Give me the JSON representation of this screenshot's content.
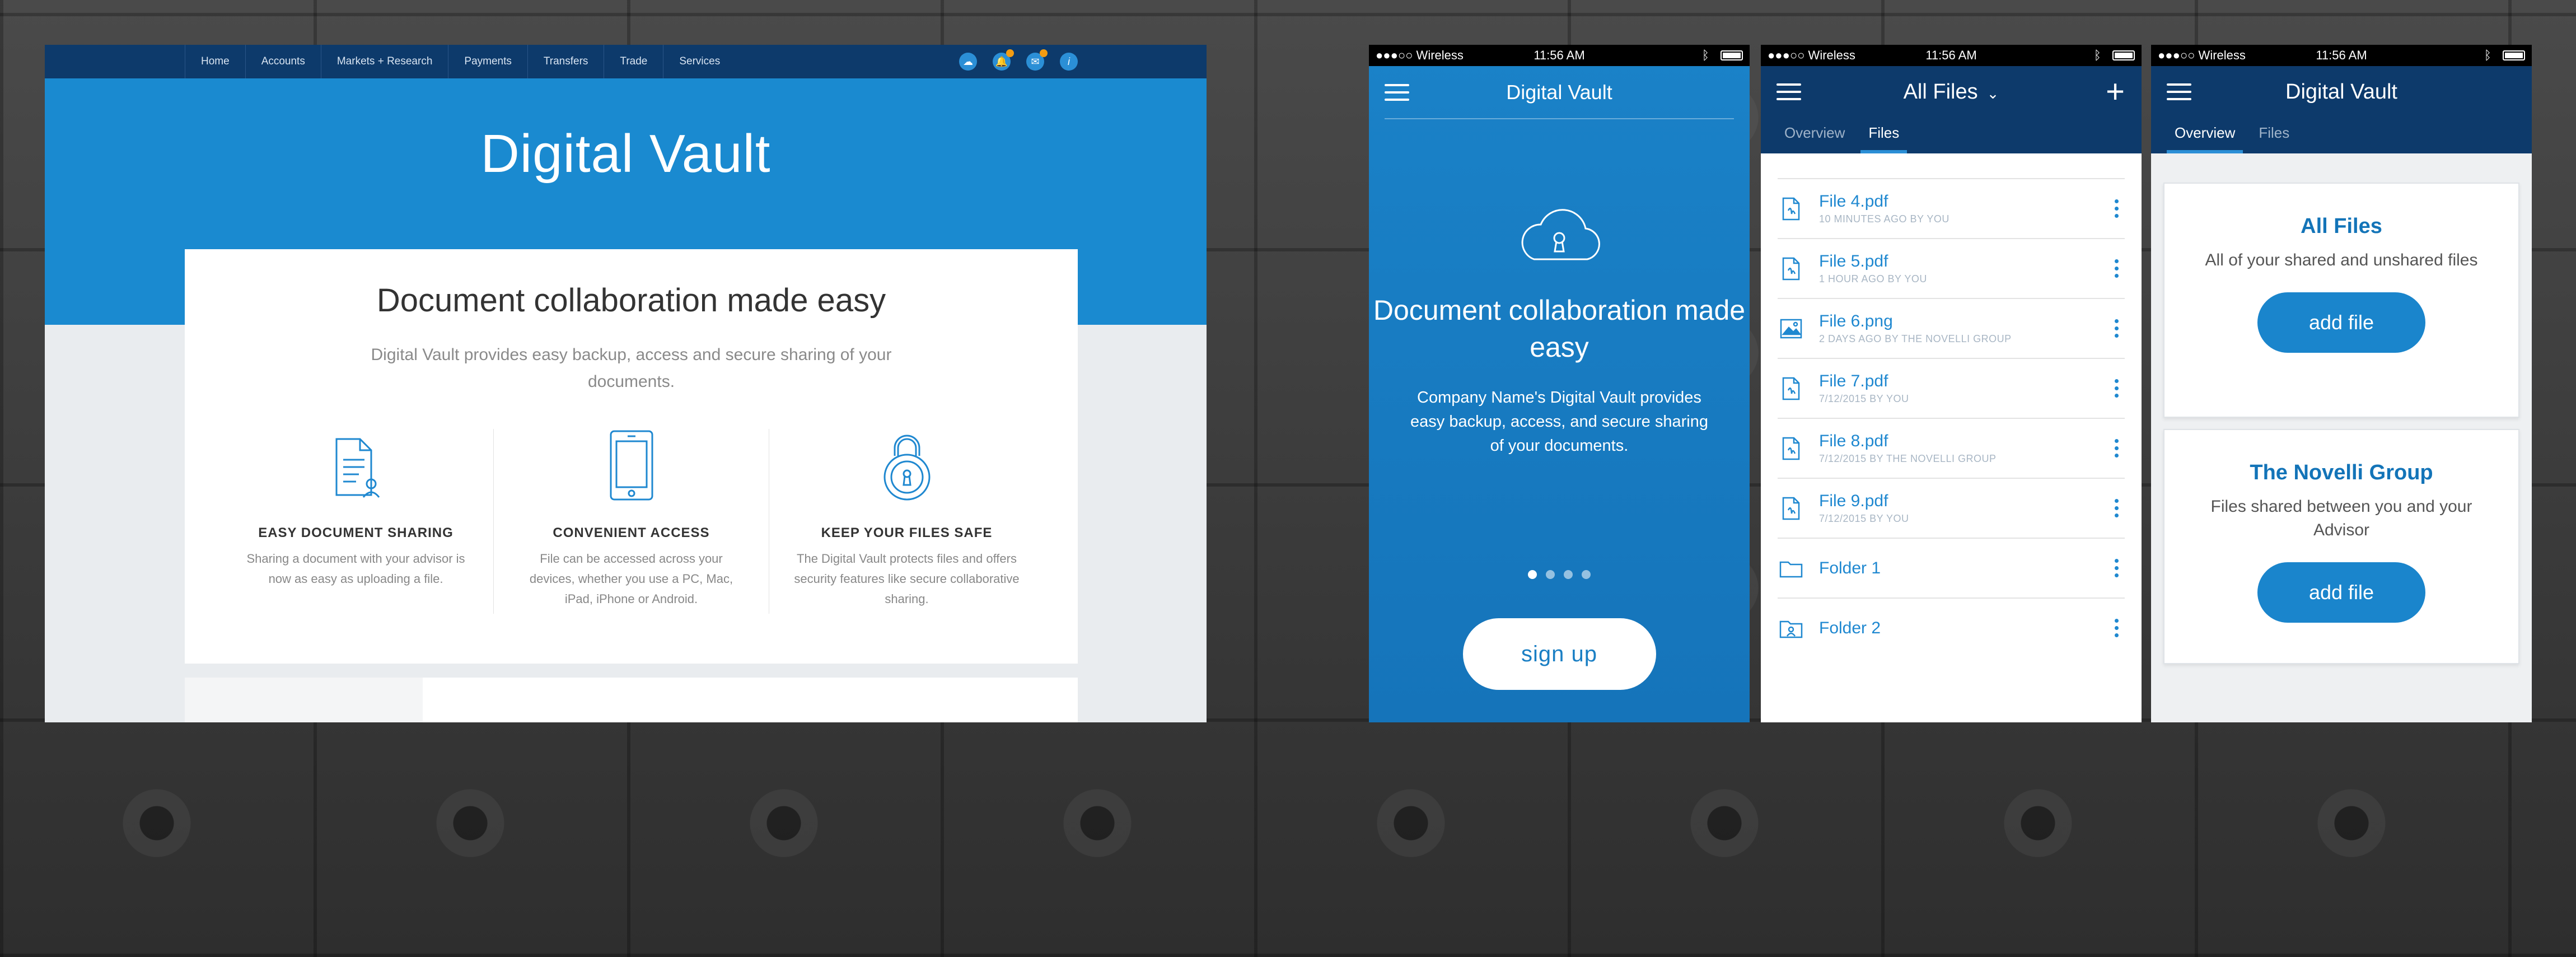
{
  "desktop": {
    "nav": {
      "items": [
        "Home",
        "Accounts",
        "Markets + Research",
        "Payments",
        "Transfers",
        "Trade",
        "Services"
      ],
      "icons": [
        "cloud-icon",
        "bell-icon",
        "mail-icon",
        "info-icon"
      ]
    },
    "hero_title": "Digital Vault",
    "card": {
      "title": "Document collaboration made easy",
      "subtitle": "Digital Vault provides easy backup, access and secure sharing of your documents.",
      "features": [
        {
          "icon": "document-share-icon",
          "title": "EASY DOCUMENT SHARING",
          "text": "Sharing a document with your advisor is now as easy as uploading a file."
        },
        {
          "icon": "tablet-icon",
          "title": "CONVENIENT ACCESS",
          "text": "File can be accessed across your devices, whether you use a PC, Mac, iPad, iPhone or Android."
        },
        {
          "icon": "padlock-icon",
          "title": "KEEP YOUR FILES SAFE",
          "text": "The Digital Vault protects files and offers security features like secure collaborative sharing."
        }
      ]
    }
  },
  "status": {
    "carrier": "●●●○○ Wireless",
    "time": "11:56 AM"
  },
  "phone1": {
    "title": "Digital Vault",
    "heading": "Document collaboration made easy",
    "body": "Company Name's Digital Vault provides easy backup, access, and secure sharing of your documents.",
    "dots": 4,
    "active_dot": 0,
    "signup_label": "sign up"
  },
  "phone2": {
    "title": "All Files",
    "tabs": [
      "Overview",
      "Files"
    ],
    "active_tab": 1,
    "files": [
      {
        "name": "File 4.pdf",
        "meta": "10 MINUTES AGO BY YOU",
        "icon": "pdf-file-icon"
      },
      {
        "name": "File 5.pdf",
        "meta": "1 HOUR AGO BY YOU",
        "icon": "pdf-file-icon"
      },
      {
        "name": "File 6.png",
        "meta": "2 DAYS AGO BY THE NOVELLI GROUP",
        "icon": "image-file-icon"
      },
      {
        "name": "File 7.pdf",
        "meta": "7/12/2015 BY YOU",
        "icon": "pdf-file-icon"
      },
      {
        "name": "File 8.pdf",
        "meta": "7/12/2015 BY THE NOVELLI GROUP",
        "icon": "pdf-file-icon"
      },
      {
        "name": "File 9.pdf",
        "meta": "7/12/2015 BY YOU",
        "icon": "pdf-file-icon"
      },
      {
        "name": "Folder 1",
        "meta": "",
        "icon": "folder-icon"
      },
      {
        "name": "Folder 2",
        "meta": "",
        "icon": "shared-folder-icon"
      }
    ]
  },
  "phone3": {
    "title": "Digital Vault",
    "tabs": [
      "Overview",
      "Files"
    ],
    "active_tab": 0,
    "cards": [
      {
        "title": "All Files",
        "text": "All of your shared and unshared files",
        "button": "add file"
      },
      {
        "title": "The Novelli Group",
        "text": "Files shared between you and your Advisor",
        "button": "add file"
      }
    ]
  }
}
